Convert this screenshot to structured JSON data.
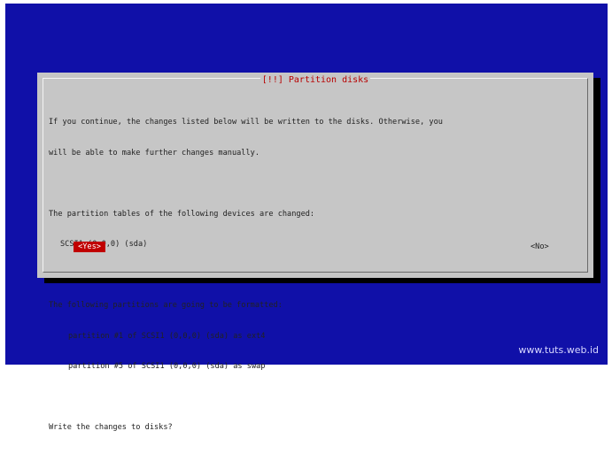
{
  "dialog": {
    "title": "[!!] Partition disks",
    "lines": [
      "If you continue, the changes listed below will be written to the disks. Otherwise, you",
      "will be able to make further changes manually.",
      "The partition tables of the following devices are changed:",
      "SCSI1 (0,0,0) (sda)",
      "The following partitions are going to be formatted:",
      "partition #1 of SCSI1 (0,0,0) (sda) as ext4",
      "partition #5 of SCSI1 (0,0,0) (sda) as swap",
      "Write the changes to disks?"
    ],
    "buttons": {
      "yes": "<Yes>",
      "no": "<No>"
    }
  },
  "watermark": "www.tuts.web.id",
  "colors": {
    "background": "#1010a8",
    "dialog": "#c6c6c6",
    "title": "#b80000",
    "selected_button": "#c00000"
  }
}
